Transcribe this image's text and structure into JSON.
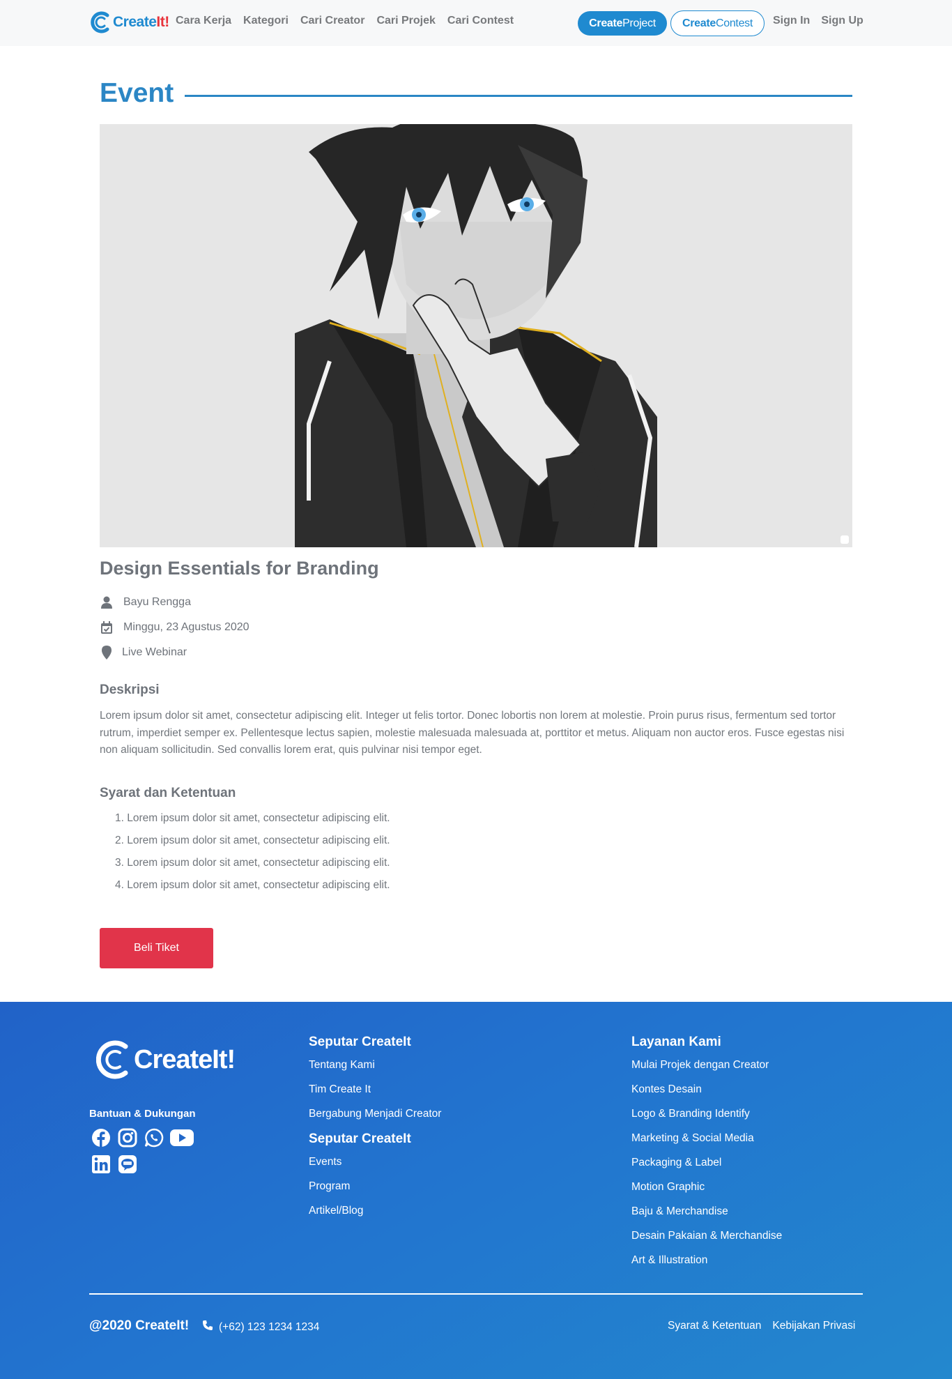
{
  "brand": {
    "logo_part1": "Create",
    "logo_part2": "It!",
    "accent_color": "#1f8ad0",
    "brand_red": "#e8343c"
  },
  "nav": {
    "links": [
      "Cara Kerja",
      "Kategori",
      "Cari Creator",
      "Cari Projek",
      "Cari Contest"
    ],
    "project_btn": {
      "bold": "Create",
      "normal": "Project"
    },
    "contest_btn": {
      "bold": "Create",
      "normal": "Contest"
    },
    "sign_in": "Sign In",
    "sign_up": "Sign Up"
  },
  "section": {
    "title": "Event"
  },
  "event": {
    "title": "Design Essentials for Branding",
    "host": "Bayu Rengga",
    "date": "Minggu, 23 Agustus 2020",
    "location": "Live Webinar",
    "host_icon": "user-icon",
    "date_icon": "calendar-check-icon",
    "location_icon": "map-marker-icon",
    "desc_heading": "Deskripsi",
    "description": "Lorem ipsum dolor sit amet, consectetur adipiscing elit. Integer ut felis tortor. Donec lobortis non lorem at molestie. Proin purus risus, fermentum sed tortor rutrum, imperdiet semper ex. Pellentesque lectus sapien, molestie malesuada malesuada at, porttitor et metus. Aliquam non auctor eros. Fusce egestas nisi non aliquam sollicitudin. Sed convallis lorem erat, quis pulvinar nisi tempor eget.",
    "terms_heading": "Syarat dan Ketentuan",
    "terms": [
      "1. Lorem ipsum dolor sit amet, consectetur adipiscing elit.",
      "2. Lorem ipsum dolor sit amet, consectetur adipiscing elit.",
      "3. Lorem ipsum dolor sit amet, consectetur adipiscing elit.",
      "4. Lorem ipsum dolor sit amet, consectetur adipiscing elit."
    ],
    "buy_button": "Beli Tiket",
    "buy_color": "#e1344a"
  },
  "footer": {
    "logo_text": "CreateIt!",
    "support_label": "Bantuan & Dukungan",
    "social_icons": [
      "facebook-icon",
      "instagram-icon",
      "whatsapp-icon",
      "youtube-icon",
      "linkedin-icon",
      "line-icon"
    ],
    "col1": {
      "heading": "Seputar CreateIt",
      "links": [
        "Tentang Kami",
        "Tim Create It",
        "Bergabung Menjadi Creator"
      ]
    },
    "col1b": {
      "heading": "Seputar CreateIt",
      "links": [
        "Events",
        "Program",
        "Artikel/Blog"
      ]
    },
    "col2": {
      "heading": "Layanan Kami",
      "links": [
        "Mulai Projek dengan Creator",
        "Kontes Desain",
        "Logo & Branding Identify",
        "Marketing & Social Media",
        "Packaging & Label",
        "Motion Graphic",
        "Baju & Merchandise",
        "Desain Pakaian & Merchandise",
        "Art & Illustration"
      ]
    },
    "copyright": "@2020 CreateIt!",
    "phone": "(+62) 123 1234 1234",
    "legal": [
      "Syarat & Ketentuan",
      "Kebijakan Privasi"
    ]
  }
}
